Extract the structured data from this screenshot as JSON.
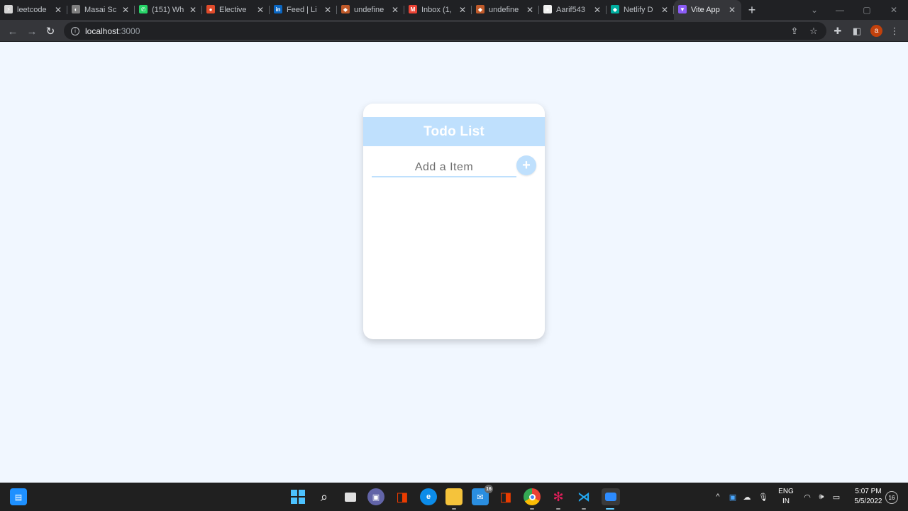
{
  "browser": {
    "tabs": [
      {
        "title": "leetcode",
        "favicon_color": "#d4d4d4",
        "favicon_glyph": "⚡"
      },
      {
        "title": "Masai Sc",
        "favicon_color": "#808080",
        "favicon_glyph": "◐"
      },
      {
        "title": "(151) Wh",
        "favicon_color": "#25d366",
        "favicon_glyph": "✆"
      },
      {
        "title": "Elective",
        "favicon_color": "#e04b2b",
        "favicon_glyph": "●"
      },
      {
        "title": "Feed | Li",
        "favicon_color": "#0a66c2",
        "favicon_glyph": "in"
      },
      {
        "title": "undefine",
        "favicon_color": "#c05a2a",
        "favicon_glyph": "◆"
      },
      {
        "title": "Inbox (1,",
        "favicon_color": "#ea4335",
        "favicon_glyph": "M"
      },
      {
        "title": "undefine",
        "favicon_color": "#c05a2a",
        "favicon_glyph": "◆"
      },
      {
        "title": "Aarif543",
        "favicon_color": "#f0f0f0",
        "favicon_glyph": "●"
      },
      {
        "title": "Netlify D",
        "favicon_color": "#00ad9f",
        "favicon_glyph": "◆"
      },
      {
        "title": "Vite App",
        "favicon_color": "#8b5cf6",
        "favicon_glyph": "▼"
      }
    ],
    "close_glyph": "✕",
    "new_tab_glyph": "+",
    "address": {
      "host": "localhost",
      "port": ":3000"
    },
    "icons": [
      "back-icon",
      "forward-icon",
      "reload-icon",
      "share-icon",
      "star-icon",
      "extensions-icon",
      "side-panel-icon",
      "menu-icon"
    ],
    "profile_initial": "a"
  },
  "app": {
    "title": "Todo List",
    "input_placeholder": "Add a Item",
    "add_glyph": "+",
    "accent": "#bfe0fd",
    "background": "#f1f7ff"
  },
  "taskbar": {
    "language": [
      "ENG",
      "IN"
    ],
    "time": "5:07 PM",
    "date": "5/5/2022",
    "mail_badge": "16",
    "notification_count": "16"
  }
}
